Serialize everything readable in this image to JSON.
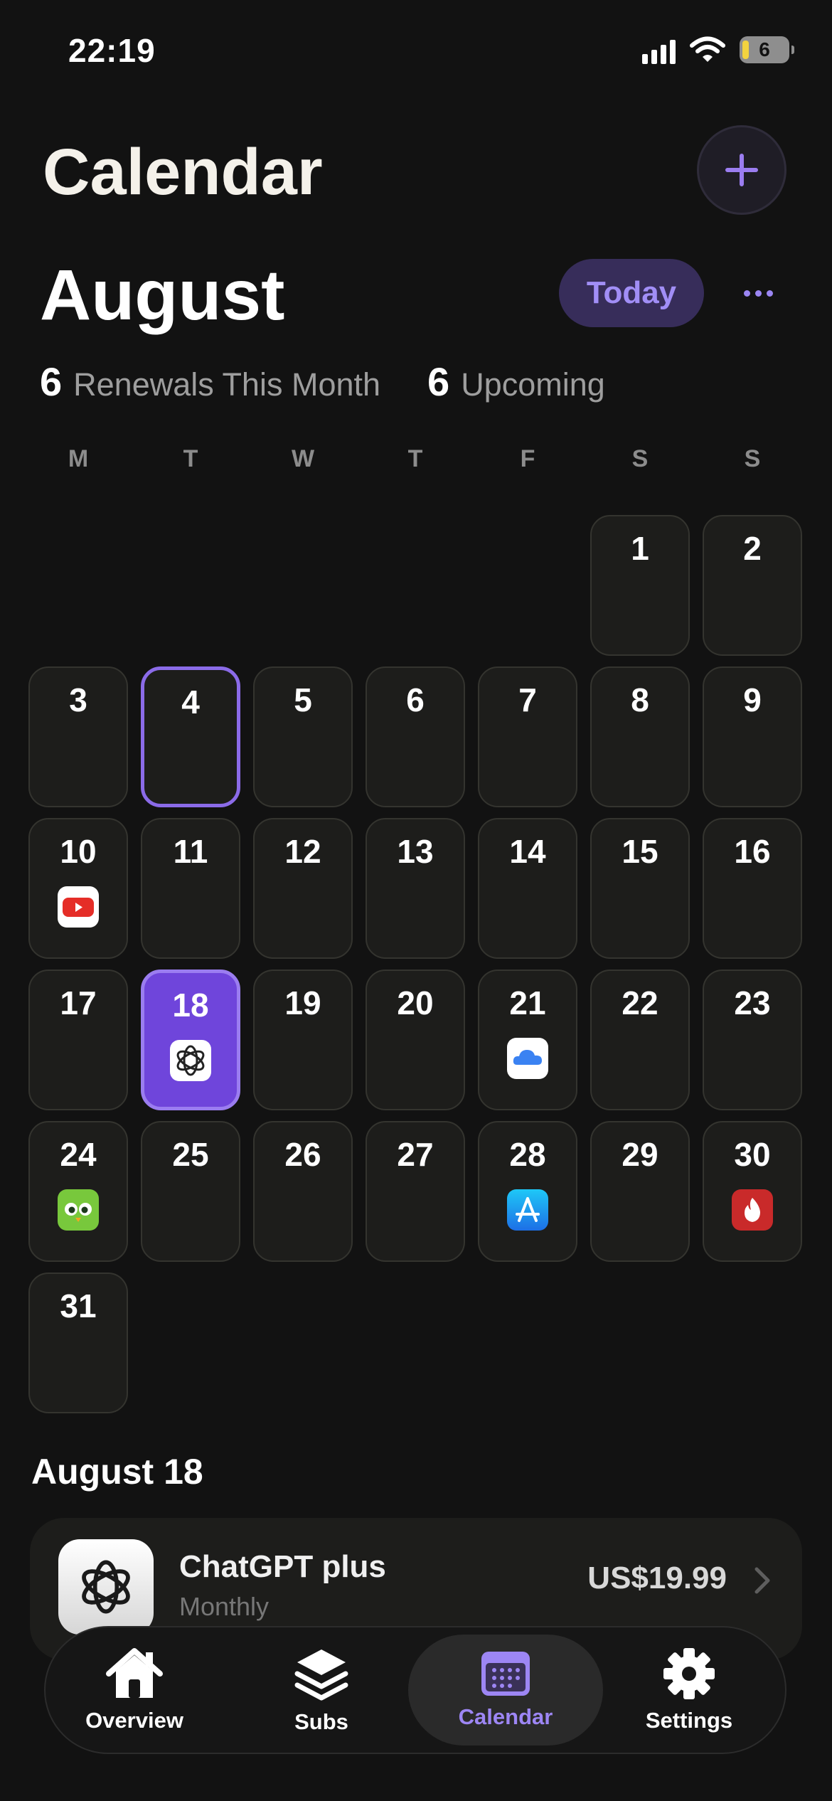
{
  "status_bar": {
    "time": "22:19",
    "battery_level": "6"
  },
  "header": {
    "title": "Calendar",
    "add_icon": "plus-icon"
  },
  "month_header": {
    "month": "August",
    "today_label": "Today",
    "more_icon": "ellipsis-icon"
  },
  "stats": {
    "renewals_count": "6",
    "renewals_label": "Renewals This Month",
    "upcoming_count": "6",
    "upcoming_label": "Upcoming"
  },
  "weekdays": [
    "M",
    "T",
    "W",
    "T",
    "F",
    "S",
    "S"
  ],
  "calendar": {
    "leading_blank_days": 5,
    "today_day": 4,
    "selected_day": 18,
    "days": [
      "1",
      "2",
      "3",
      "4",
      "5",
      "6",
      "7",
      "8",
      "9",
      "10",
      "11",
      "12",
      "13",
      "14",
      "15",
      "16",
      "17",
      "18",
      "19",
      "20",
      "21",
      "22",
      "23",
      "24",
      "25",
      "26",
      "27",
      "28",
      "29",
      "30",
      "31"
    ],
    "subscription_markers": {
      "10": "youtube-icon",
      "18": "chatgpt-icon",
      "21": "icloud-icon",
      "24": "duolingo-icon",
      "28": "app-store-icon",
      "30": "tinder-icon"
    }
  },
  "selected_section": {
    "title": "August 18",
    "subscription": {
      "name": "ChatGPT plus",
      "cycle": "Monthly",
      "price": "US$19.99",
      "icon": "chatgpt-icon"
    }
  },
  "tab_bar": {
    "tabs": [
      {
        "label": "Overview",
        "icon": "house-icon"
      },
      {
        "label": "Subs",
        "icon": "layers-icon"
      },
      {
        "label": "Calendar",
        "icon": "calendar-icon"
      },
      {
        "label": "Settings",
        "icon": "gear-icon"
      }
    ],
    "active": "Calendar"
  },
  "colors": {
    "accent": "#8b6be8",
    "selected_day": "#6f45db",
    "background": "#121212",
    "cell": "#1d1d1b"
  }
}
